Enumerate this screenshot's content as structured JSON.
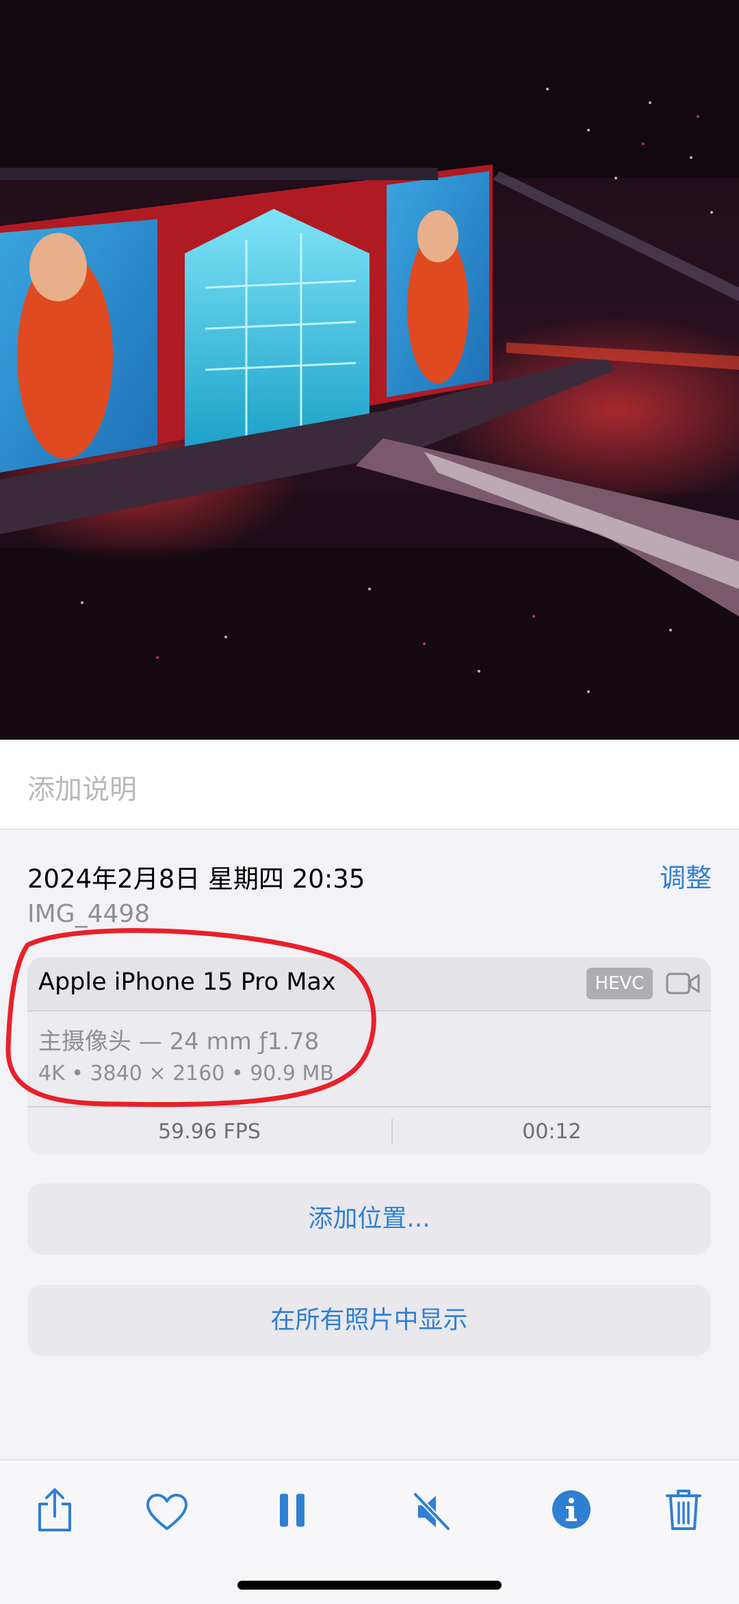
{
  "photo": {
    "description_icon": "concert-photo"
  },
  "caption": {
    "placeholder": "添加说明"
  },
  "info": {
    "datetime": "2024年2月8日 星期四 20:35",
    "adjust_label": "调整",
    "filename": "IMG_4498"
  },
  "metadata": {
    "device": "Apple iPhone 15 Pro Max",
    "format_badge": "HEVC",
    "lens": "主摄像头 — 24 mm ƒ1.78",
    "specs": "4K • 3840 × 2160 • 90.9 MB",
    "fps": "59.96 FPS",
    "duration": "00:12"
  },
  "actions": {
    "add_location": "添加位置...",
    "show_in_all_photos": "在所有照片中显示"
  },
  "toolbar": {
    "icons": [
      "share-icon",
      "heart-icon",
      "pause-icon",
      "mute-icon",
      "info-icon",
      "trash-icon"
    ]
  },
  "colors": {
    "accent": "#2f7fd3",
    "annotation": "#e8202a"
  }
}
